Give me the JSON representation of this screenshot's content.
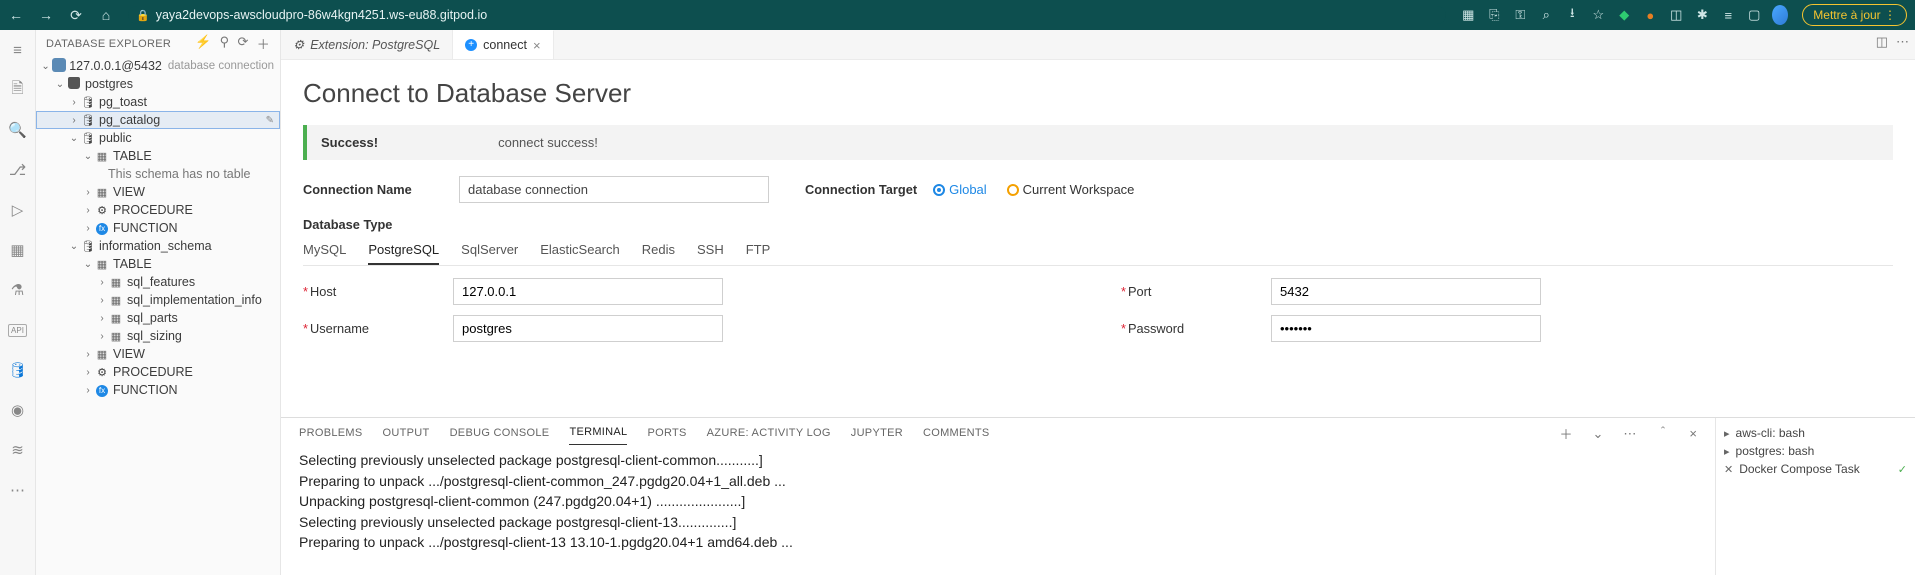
{
  "browser": {
    "url": "yaya2devops-awscloudpro-86w4kgn4251.ws-eu88.gitpod.io",
    "update_label": "Mettre à jour"
  },
  "sidebar": {
    "title": "DATABASE EXPLORER",
    "connection": {
      "label": "127.0.0.1@5432",
      "detail": "database connection"
    },
    "db_postgres": "postgres",
    "schema_pg_toast": "pg_toast",
    "schema_pg_catalog": "pg_catalog",
    "schema_public": "public",
    "table_grp": "TABLE",
    "no_table_msg": "This schema has no table",
    "view_grp": "VIEW",
    "procedure_grp": "PROCEDURE",
    "function_grp": "FUNCTION",
    "schema_info": "information_schema",
    "t_sql_features": "sql_features",
    "t_sql_impl": "sql_implementation_info",
    "t_sql_parts": "sql_parts",
    "t_sql_sizing": "sql_sizing"
  },
  "tabs": {
    "ext": "Extension: PostgreSQL",
    "connect": "connect"
  },
  "page": {
    "title": "Connect to Database Server",
    "alert_head": "Success!",
    "alert_msg": "connect success!",
    "conn_name_label": "Connection Name",
    "conn_name_value": "database connection",
    "conn_target_label": "Connection Target",
    "target_global": "Global",
    "target_workspace": "Current Workspace",
    "db_type_label": "Database Type",
    "db_types": [
      "MySQL",
      "PostgreSQL",
      "SqlServer",
      "ElasticSearch",
      "Redis",
      "SSH",
      "FTP"
    ],
    "host_label": "Host",
    "host_value": "127.0.0.1",
    "port_label": "Port",
    "port_value": "5432",
    "user_label": "Username",
    "user_value": "postgres",
    "pass_label": "Password",
    "pass_value": "•••••••"
  },
  "panel": {
    "tabs": [
      "PROBLEMS",
      "OUTPUT",
      "DEBUG CONSOLE",
      "TERMINAL",
      "PORTS",
      "AZURE: ACTIVITY LOG",
      "JUPYTER",
      "COMMENTS"
    ],
    "lines": [
      "Selecting previously unselected package postgresql-client-common...........]",
      "Preparing to unpack .../postgresql-client-common_247.pgdg20.04+1_all.deb ...",
      "Unpacking postgresql-client-common (247.pgdg20.04+1) ......................]",
      "Selecting previously unselected package postgresql-client-13..............]",
      "Preparing to unpack .../postgresql-client-13 13.10-1.pgdg20.04+1 amd64.deb ..."
    ],
    "side": {
      "aws": "aws-cli: bash",
      "pg": "postgres: bash",
      "docker": "Docker Compose Task"
    }
  }
}
